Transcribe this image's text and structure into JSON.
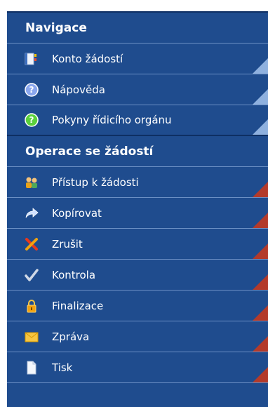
{
  "sections": [
    {
      "title": "Navigace",
      "items": [
        {
          "label": "Konto žádostí",
          "icon": "notebook-icon",
          "corner": "light"
        },
        {
          "label": "Nápověda",
          "icon": "help-question-icon",
          "corner": "light"
        },
        {
          "label": "Pokyny řídicího orgánu",
          "icon": "green-question-icon",
          "corner": "light"
        }
      ]
    },
    {
      "title": "Operace se žádostí",
      "items": [
        {
          "label": "Přístup k žádosti",
          "icon": "users-icon",
          "corner": "red"
        },
        {
          "label": "Kopírovat",
          "icon": "arrow-forward-icon",
          "corner": "red"
        },
        {
          "label": "Zrušit",
          "icon": "cancel-tools-icon",
          "corner": "red"
        },
        {
          "label": "Kontrola",
          "icon": "checkmark-icon",
          "corner": "red"
        },
        {
          "label": "Finalizace",
          "icon": "padlock-icon",
          "corner": "red"
        },
        {
          "label": "Zpráva",
          "icon": "envelope-icon",
          "corner": "red"
        },
        {
          "label": "Tisk",
          "icon": "document-icon",
          "corner": "red"
        }
      ]
    }
  ],
  "colors": {
    "panel_bg": "#1f4c8e",
    "divider": "#6b8fc4",
    "corner_red": "#b33a2a",
    "corner_light": "#8fb1df"
  }
}
